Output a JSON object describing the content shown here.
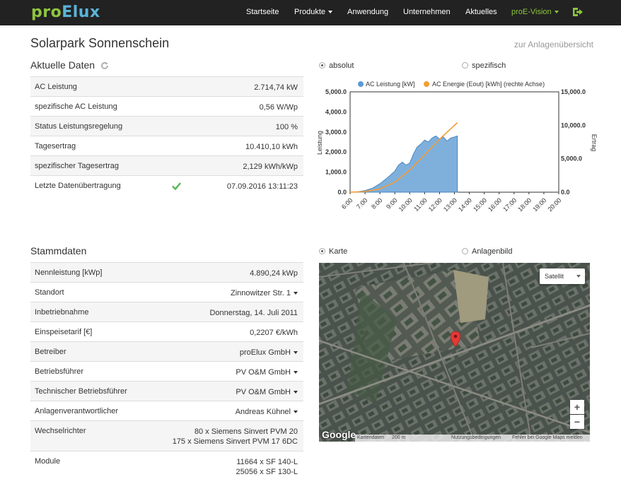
{
  "nav": {
    "brand_pro": "pro",
    "brand_elux": "Elux",
    "items": [
      {
        "label": "Startseite"
      },
      {
        "label": "Produkte"
      },
      {
        "label": "Anwendung"
      },
      {
        "label": "Unternehmen"
      },
      {
        "label": "Aktuelles"
      },
      {
        "label": "proE-Vision"
      }
    ],
    "logout_icon": "sign-out-icon"
  },
  "page": {
    "title": "Solarpark Sonnenschein",
    "overview_link": "zur Anlagenübersicht"
  },
  "current": {
    "title": "Aktuelle Daten",
    "rows": [
      {
        "label": "AC Leistung",
        "value": "2.714,74 kW"
      },
      {
        "label": "spezifische AC Leistung",
        "value": "0,56 W/Wp"
      },
      {
        "label": "Status Leistungsregelung",
        "value": "100 %"
      },
      {
        "label": "Tagesertrag",
        "value": "10.410,10 kWh"
      },
      {
        "label": "spezifischer Tagesertrag",
        "value": "2,129 kWh/kWp"
      },
      {
        "label": "Letzte Datenübertragung",
        "value": "07.09.2016 13:11:23"
      }
    ]
  },
  "chart_toggle": {
    "absolut": "absolut",
    "spezifisch": "spezifisch",
    "selected": "absolut"
  },
  "chart_data": {
    "type": "area",
    "x": [
      "6:00",
      "7:00",
      "8:00",
      "9:00",
      "10:00",
      "11:00",
      "12:00",
      "13:00",
      "14:00",
      "15:00",
      "16:00",
      "17:00",
      "18:00",
      "19:00",
      "20:00"
    ],
    "series": [
      {
        "name": "AC Leistung [kW]",
        "type": "area",
        "axis": "left",
        "x": [
          6.0,
          6.5,
          7.0,
          7.5,
          8.0,
          8.5,
          9.0,
          9.25,
          9.5,
          9.75,
          10.0,
          10.25,
          10.5,
          10.75,
          11.0,
          11.25,
          11.5,
          11.75,
          12.0,
          12.25,
          12.5,
          12.75,
          13.0,
          13.2
        ],
        "values": [
          0,
          20,
          80,
          200,
          420,
          720,
          1050,
          1350,
          1500,
          1350,
          1450,
          1900,
          2250,
          2400,
          2600,
          2500,
          2700,
          2800,
          2650,
          2750,
          2550,
          2700,
          2750,
          2800
        ]
      },
      {
        "name": "AC Energie (Eout) [kWh] (rechte Achse)",
        "type": "line",
        "axis": "right",
        "x": [
          6.0,
          7.0,
          8.0,
          9.0,
          10.0,
          11.0,
          12.0,
          13.2
        ],
        "values": [
          0,
          80,
          500,
          1500,
          3300,
          5600,
          7900,
          10400
        ]
      }
    ],
    "ylabel": "Leistung",
    "y2label": "Ertrag",
    "ylim": [
      0,
      5000
    ],
    "y2lim": [
      0,
      15000
    ],
    "yticks": [
      "0.0",
      "1,000.0",
      "2,000.0",
      "3,000.0",
      "4,000.0",
      "5,000.0"
    ],
    "y2ticks": [
      "0.0",
      "5,000.0",
      "10,000.0",
      "15,000.0"
    ],
    "xlim": [
      6,
      20
    ],
    "colors": {
      "power": "#5a9bd5",
      "power_fill": "#7fb0db",
      "energy": "#f39c35"
    },
    "legend": "top"
  },
  "master": {
    "title": "Stammdaten",
    "rows": [
      {
        "label": "Nennleistung [kWp]",
        "value": "4.890,24 kWp"
      },
      {
        "label": "Standort",
        "value": "Zinnowitzer Str. 1"
      },
      {
        "label": "Inbetriebnahme",
        "value": "Donnerstag, 14. Juli 2011"
      },
      {
        "label": "Einspeisetarif [€]",
        "value": "0,2207 €/kWh"
      },
      {
        "label": "Betreiber",
        "value": "proElux GmbH"
      },
      {
        "label": "Betriebsführer",
        "value": "PV O&M GmbH"
      },
      {
        "label": "Technischer Betriebsführer",
        "value": "PV O&M GmbH"
      },
      {
        "label": "Anlagenverantwortlicher",
        "value": "Andreas Kühnel"
      },
      {
        "label": "Wechselrichter",
        "value1": "80 x Siemens Sinvert PVM 20",
        "value2": "175 x Siemens Sinvert PVM 17 6DC"
      },
      {
        "label": "Module",
        "value1": "11664 x SF 140-L",
        "value2": "25056 x SF 130-L"
      }
    ]
  },
  "map_toggle": {
    "karte": "Karte",
    "anlagenbild": "Anlagenbild",
    "selected": "Karte"
  },
  "map": {
    "type_select": "Satellit",
    "zoom_in": "+",
    "zoom_out": "−",
    "logo": "Google",
    "footer": {
      "kartendaten": "Kartendaten",
      "scale": "200 m",
      "terms": "Nutzungsbedingungen",
      "report": "Fehler bei Google Maps melden"
    },
    "marker_icon": "map-pin-icon"
  }
}
